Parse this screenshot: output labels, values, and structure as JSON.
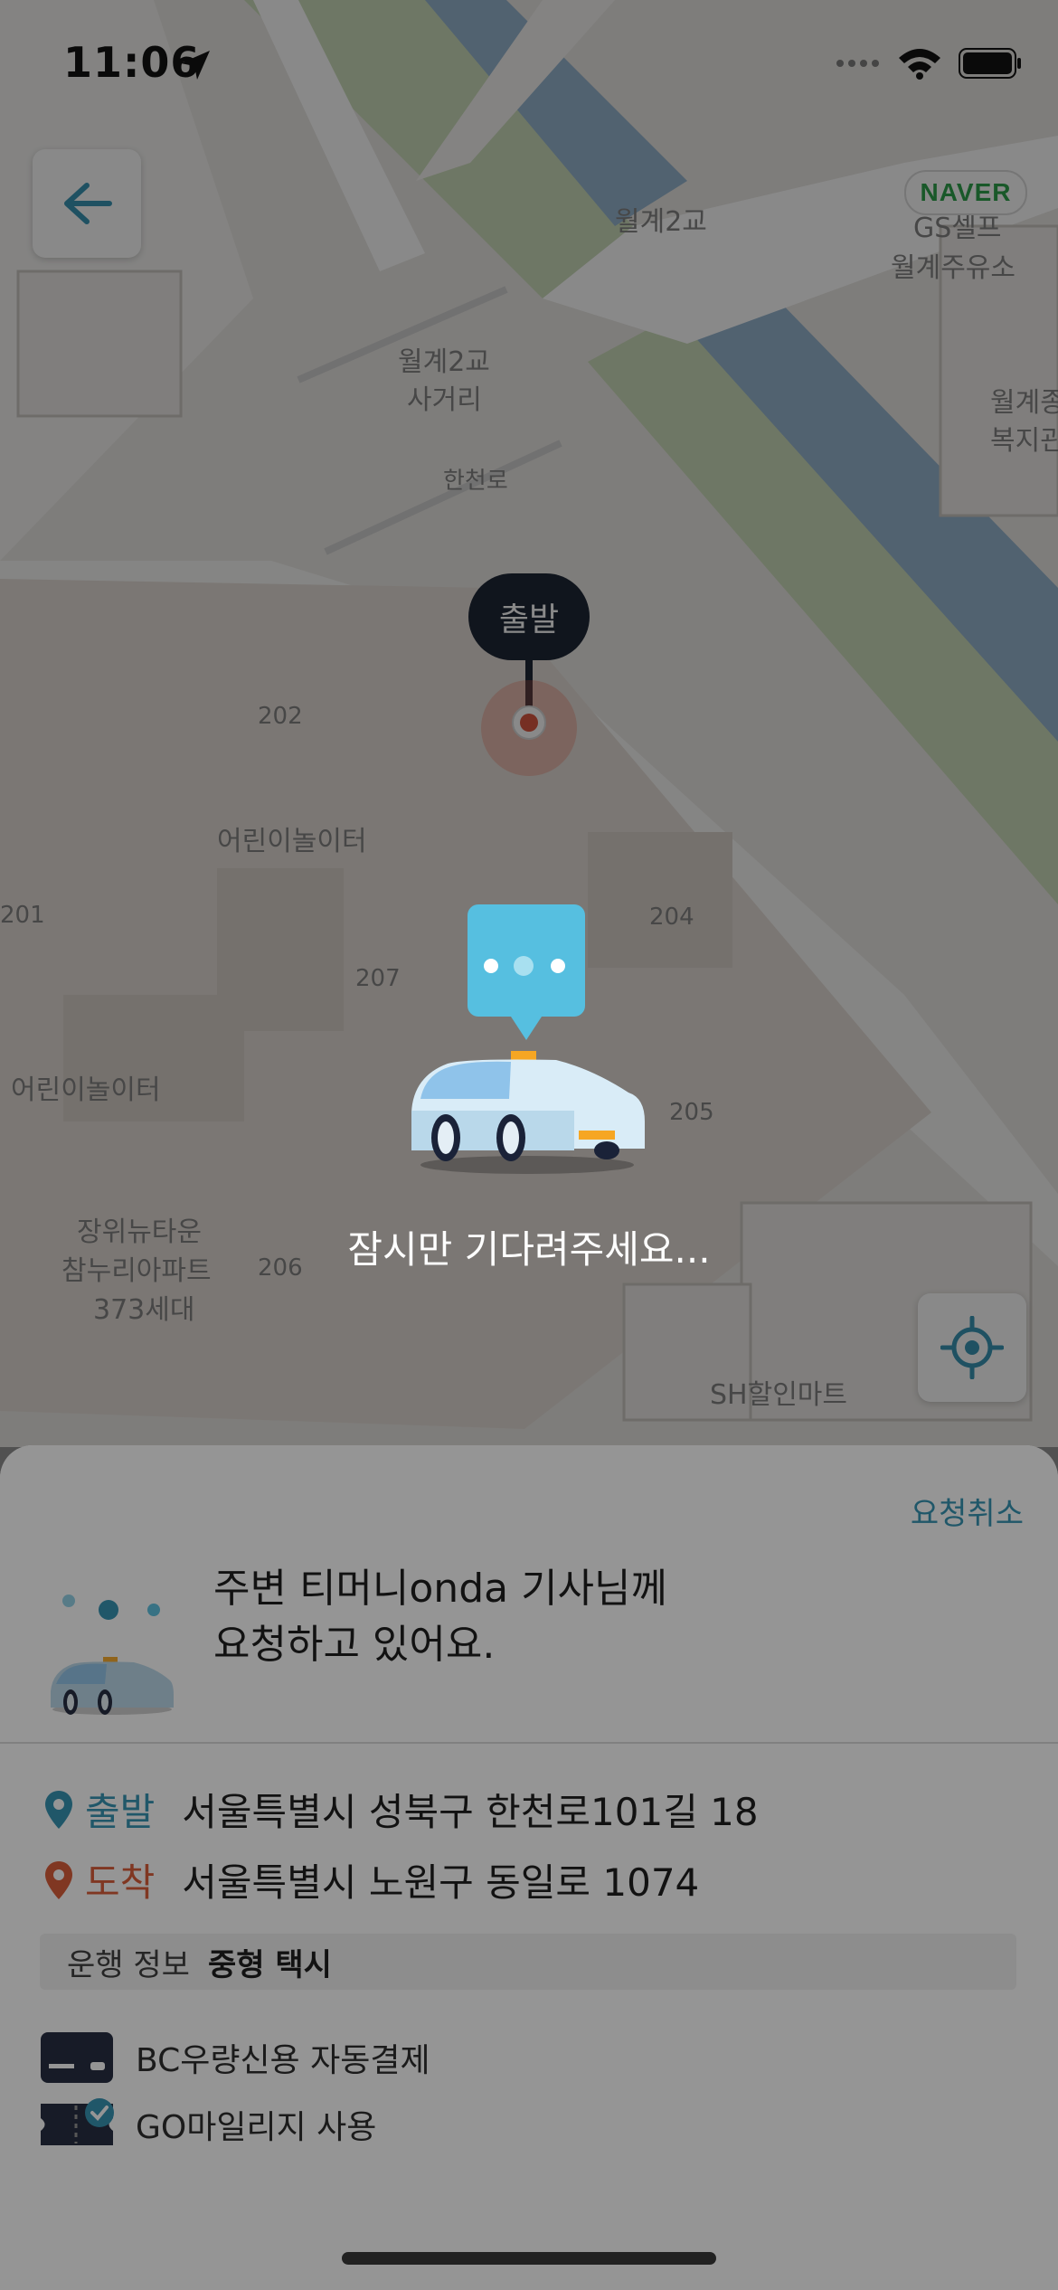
{
  "status_bar": {
    "time": "11:06"
  },
  "map": {
    "brand": "NAVER",
    "labels": [
      "월계2교",
      "월계2교 사거리",
      "한천로",
      "GS셀프 월계주유소",
      "월계종합 복지관",
      "202",
      "204",
      "205",
      "206",
      "207",
      "201",
      "어린이놀이터",
      "어린이놀이터",
      "장위뉴타운 참누리아파트 373세대",
      "SH할인마트"
    ],
    "pin_label": "출발"
  },
  "waiting_text": "잠시만 기다려주세요...",
  "sheet": {
    "cancel_label": "요청취소",
    "request_line1": "주변 티머니onda 기사님께",
    "request_line2": "요청하고 있어요.",
    "departure_tag": "출발",
    "departure_address": "서울특별시 성북구 한천로101길 18",
    "arrival_tag": "도착",
    "arrival_address": "서울특별시 노원구 동일로 1074",
    "service_label": "운행 정보",
    "service_value": "중형 택시",
    "payment_label": "BC우량신용 자동결제",
    "mileage_label": "GO마일리지 사용"
  },
  "colors": {
    "accent": "#2b8fb0",
    "departure": "#2b8fb0",
    "arrival": "#d9542f",
    "pin_label_bg": "#0d1626",
    "naver_green": "#1e9d3e"
  }
}
